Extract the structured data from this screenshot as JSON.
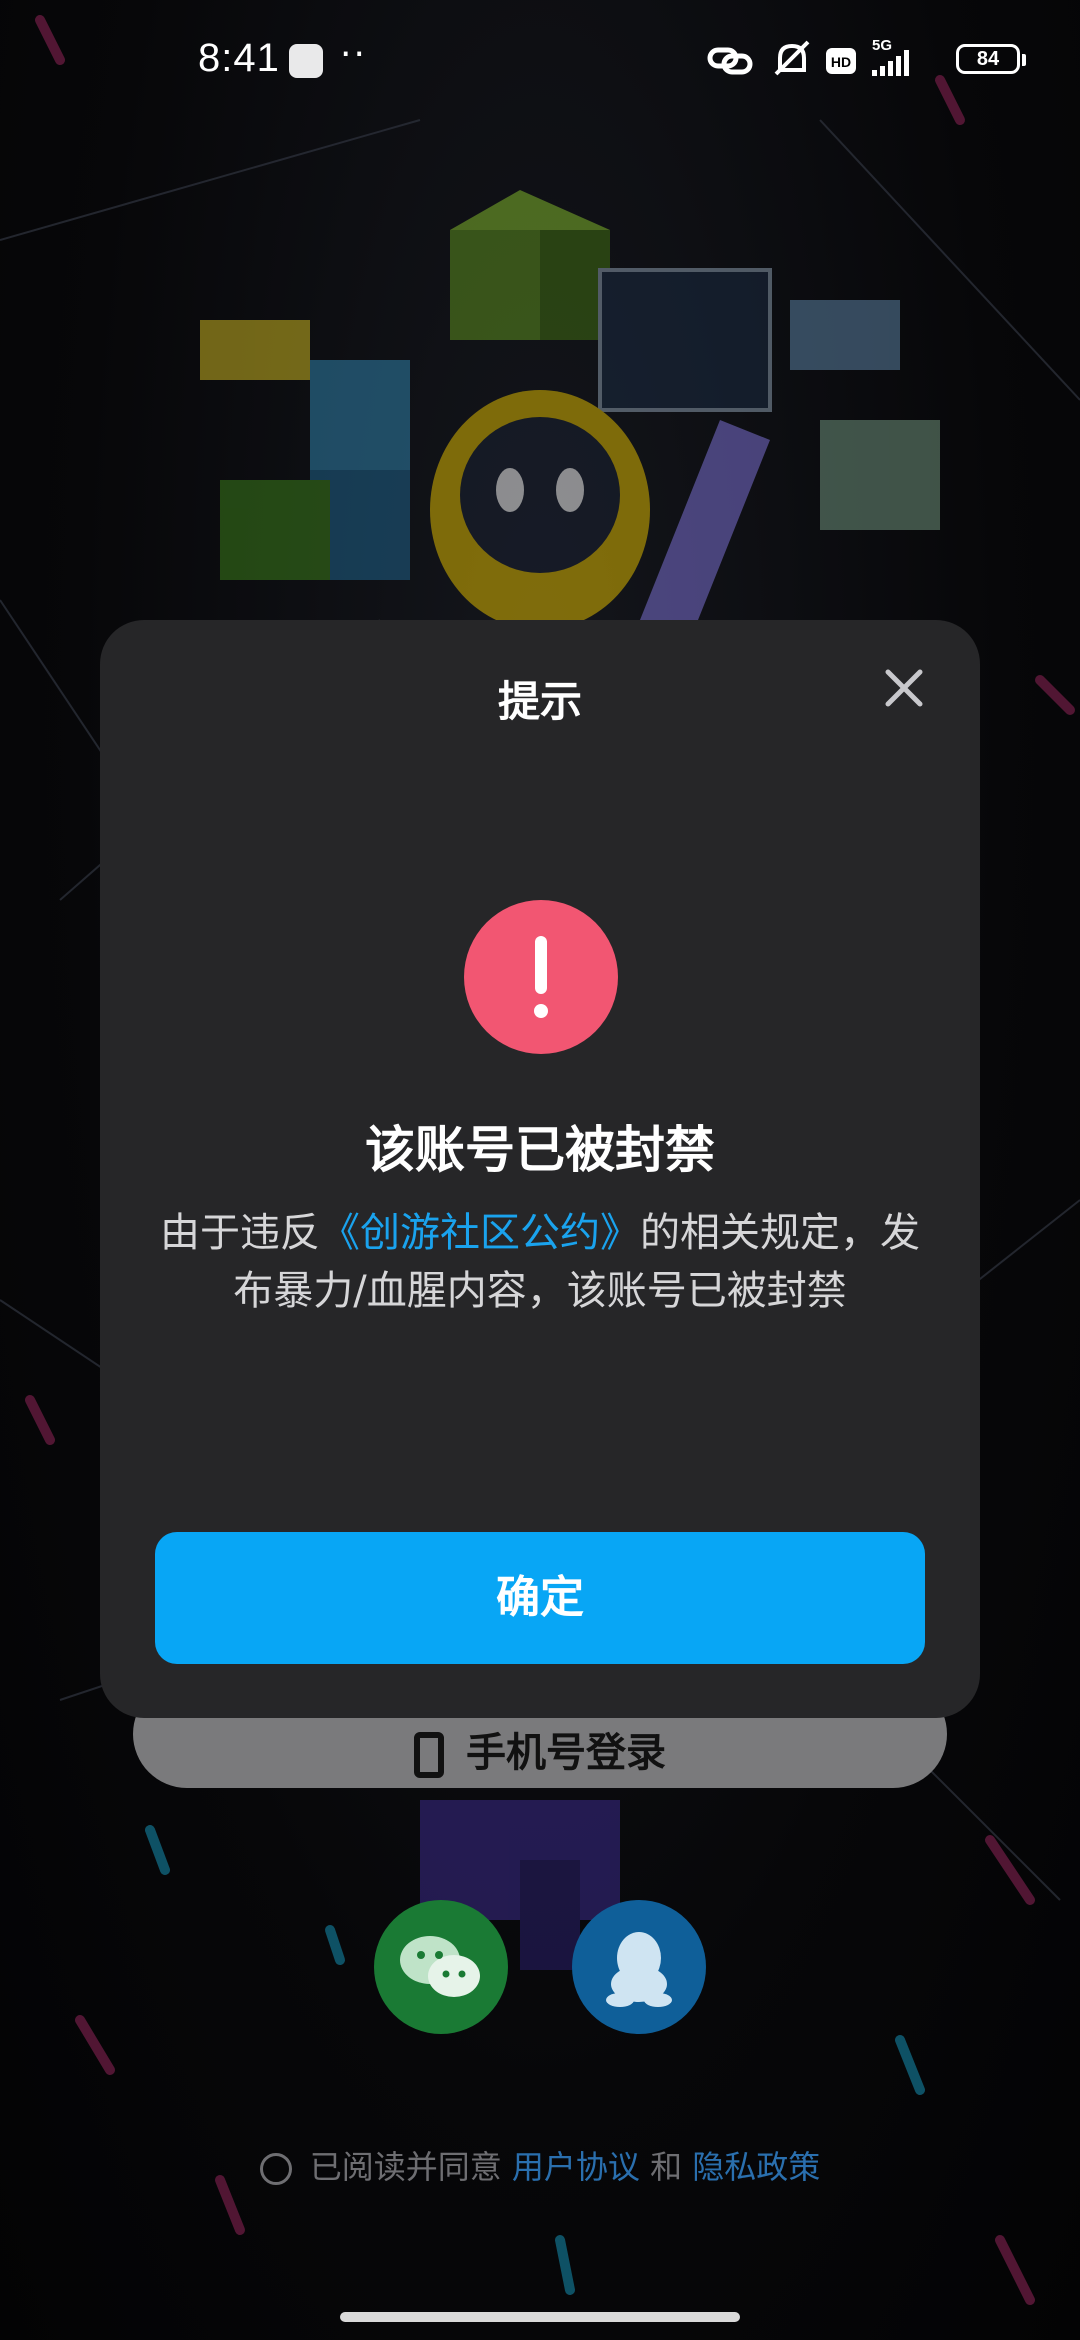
{
  "status_bar": {
    "time": "8:41",
    "dots": "··",
    "network": "5G",
    "hd_badge": "HD",
    "battery": "84"
  },
  "login": {
    "phone_login_label": "手机号登录",
    "wechat_icon": "wechat-icon",
    "qq_icon": "qq-icon",
    "agreement": {
      "prefix": "已阅读并同意",
      "user_agreement": "用户协议",
      "and": "和",
      "privacy_policy": "隐私政策"
    }
  },
  "dialog": {
    "title": "提示",
    "heading": "该账号已被封禁",
    "message_prefix": "由于违反",
    "message_link": "《创游社区公约》",
    "message_suffix": "的相关规定，发布暴力/血腥内容，该账号已被封禁",
    "confirm_label": "确定"
  },
  "colors": {
    "dialog_bg": "#262628",
    "alert": "#f25672",
    "primary": "#08a6f5",
    "link": "#1aa3ee"
  }
}
